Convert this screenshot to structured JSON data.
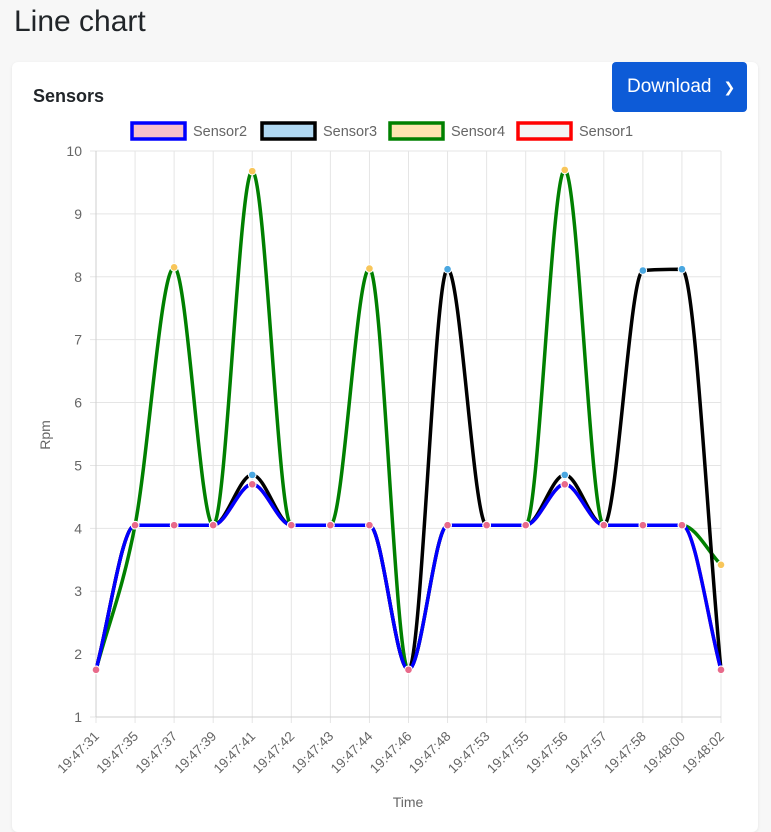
{
  "page": {
    "title": "Line chart"
  },
  "card": {
    "title": "Sensors"
  },
  "download": {
    "label": "Download",
    "icon": "chevron-down-icon"
  },
  "chart_data": {
    "type": "line",
    "title": "",
    "xlabel": "Time",
    "ylabel": "Rpm",
    "ylim": [
      1,
      10
    ],
    "yticks": [
      1,
      2,
      3,
      4,
      5,
      6,
      7,
      8,
      9,
      10
    ],
    "grid": true,
    "legend_position": "top",
    "categories": [
      "19:47:31",
      "19:47:35",
      "19:47:37",
      "19:47:39",
      "19:47:41",
      "19:47:42",
      "19:47:43",
      "19:47:44",
      "19:47:46",
      "19:47:48",
      "19:47:53",
      "19:47:55",
      "19:47:56",
      "19:47:57",
      "19:47:58",
      "19:48:00",
      "19:48:02"
    ],
    "series": [
      {
        "name": "Sensor2",
        "line_color": "#0000ff",
        "fill_color": "#f8c0cc",
        "point_color": "#e86a8a",
        "values": [
          1.75,
          4.05,
          4.05,
          4.05,
          4.7,
          4.05,
          4.05,
          4.05,
          1.75,
          4.05,
          4.05,
          4.05,
          4.7,
          4.05,
          4.05,
          4.05,
          1.75
        ]
      },
      {
        "name": "Sensor3",
        "line_color": "#000000",
        "fill_color": "#b0d8f2",
        "point_color": "#4aa7e0",
        "values": [
          1.75,
          4.05,
          4.05,
          4.05,
          4.85,
          4.05,
          4.05,
          4.05,
          1.75,
          8.12,
          4.05,
          4.05,
          4.85,
          4.05,
          8.1,
          8.12,
          1.75
        ]
      },
      {
        "name": "Sensor4",
        "line_color": "#008000",
        "fill_color": "#fde4b0",
        "point_color": "#f8c65a",
        "values": [
          1.75,
          4.05,
          8.15,
          4.05,
          9.68,
          4.05,
          4.05,
          8.13,
          1.75,
          4.05,
          4.05,
          4.05,
          9.7,
          4.05,
          4.05,
          4.05,
          3.42
        ]
      },
      {
        "name": "Sensor1",
        "line_color": "#ff0000",
        "fill_color": "#f4f4f4",
        "point_color": "#e86a8a",
        "values": [
          1.75,
          4.05,
          4.05,
          4.05,
          4.7,
          4.05,
          4.05,
          4.05,
          1.75,
          4.05,
          4.05,
          4.05,
          4.7,
          4.05,
          4.05,
          4.05,
          1.75
        ]
      }
    ]
  }
}
